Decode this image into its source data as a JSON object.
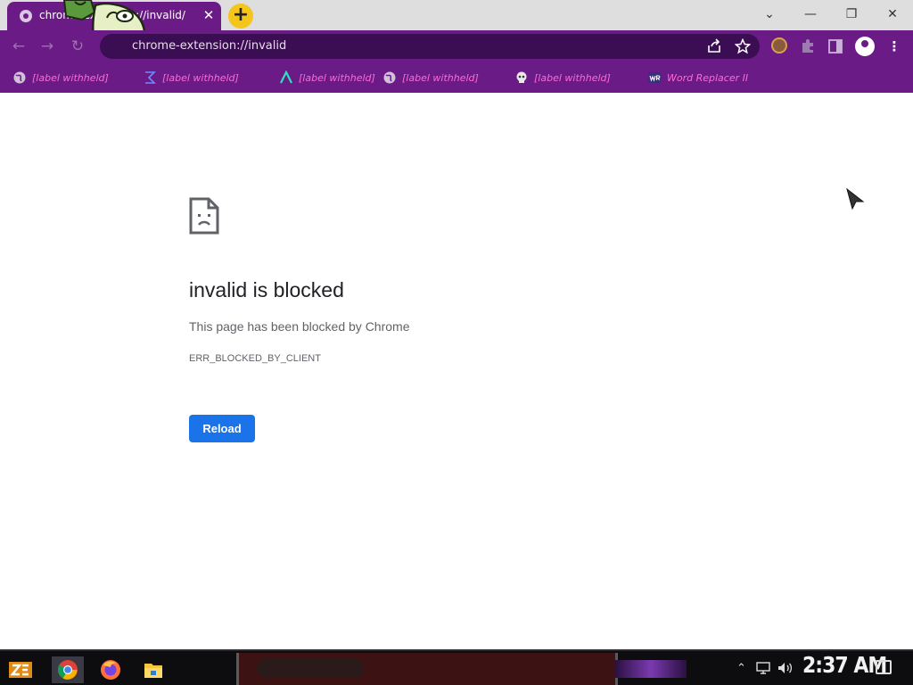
{
  "colors": {
    "accent": "#6a1b86",
    "omnibox_bg": "#3b0d52",
    "bookmark_text": "#ff6ad5",
    "button_blue": "#1a73e8",
    "newtab_yellow": "#f4c51b"
  },
  "tab": {
    "title": "chrome-extension://invalid/",
    "close_glyph": "✕",
    "favicon": "globe-icon"
  },
  "window": {
    "minimize": "—",
    "restore": "❐",
    "close": "✕",
    "tab_search": "⌄"
  },
  "toolbar": {
    "back": "←",
    "forward": "→",
    "reload": "↻",
    "address": "chrome-extension://invalid",
    "share_icon": "share-icon",
    "star_icon": "star-icon",
    "extensions_icon": "puzzle-icon",
    "sidepanel_icon": "side-panel-icon",
    "menu_icon": "kebab-menu-icon"
  },
  "bookmarks": [
    {
      "label": "[label withheld]",
      "icon": "globe-icon"
    },
    {
      "label": "[label withheld]",
      "icon": "sigma-icon"
    },
    {
      "label": "[label withheld]",
      "icon": "a-logo-icon"
    },
    {
      "label": "[label withheld]",
      "icon": "globe-icon"
    },
    {
      "label": "[label withheld]",
      "icon": "skull-icon"
    },
    {
      "label": "Word Replacer II",
      "icon": "wr-icon"
    }
  ],
  "error": {
    "title": "invalid is blocked",
    "description": "This page has been blocked by Chrome",
    "code": "ERR_BLOCKED_BY_CLIENT",
    "reload_label": "Reload"
  },
  "taskbar": {
    "clock": "2:37 AM",
    "apps": [
      "chrome-icon",
      "firefox-icon",
      "file-explorer-icon"
    ]
  }
}
